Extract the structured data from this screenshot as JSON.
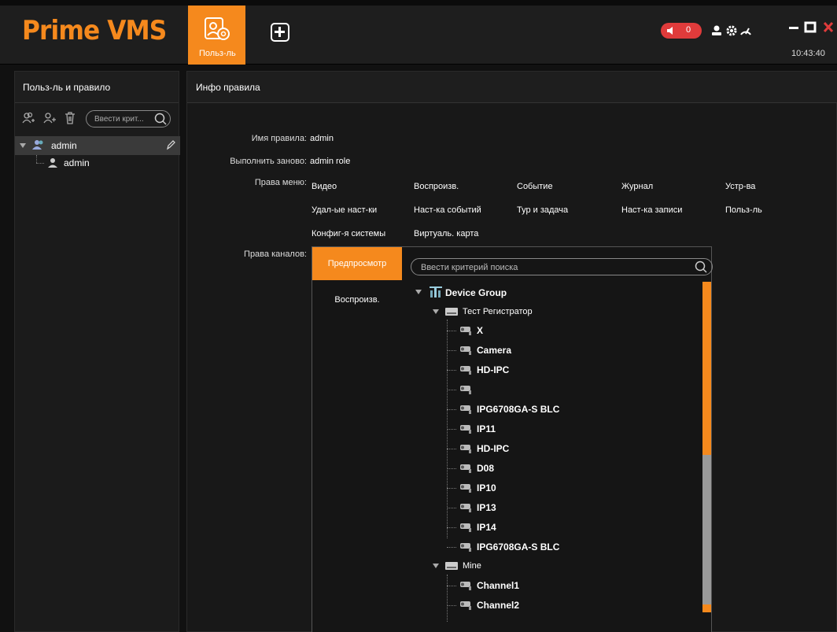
{
  "app": {
    "logo": "Prime VMS",
    "clock": "10:43:40"
  },
  "header": {
    "user_tab_label": "Польз-ль",
    "alarm_count": "0"
  },
  "left": {
    "title": "Польз-ль и правило",
    "search_placeholder": "Ввести крит...",
    "tree": {
      "group": "admin",
      "child": "admin"
    }
  },
  "right": {
    "title": "Инфо правила",
    "rule_name_label": "Имя правила:",
    "rule_name_value": "admin",
    "redo_label": "Выполнить заново:",
    "redo_value": "admin role",
    "menu_rights_label": "Права меню:",
    "menu_rights": [
      "Видео",
      "Воспроизв.",
      "Событие",
      "Журнал",
      "Устр-ва",
      "Удал-ые наст-ки",
      "Наст-ка событий",
      "Тур и задача",
      "Наст-ка записи",
      "Польз-ль",
      "Конфиг-я системы",
      "Виртуаль. карта"
    ],
    "channel_rights_label": "Права каналов:",
    "channel_tabs": [
      "Предпросмотр",
      "Воспроизв."
    ],
    "channel_search_placeholder": "Ввести критерий поиска",
    "device_tree": {
      "root": "Device Group",
      "recorders": [
        {
          "name": "Тест Регистратор",
          "channels": [
            "X",
            "Camera",
            "HD-IPC",
            "",
            "IPG6708GA-S BLC",
            "IP11",
            "HD-IPC",
            "D08",
            "IP10",
            "IP13",
            "IP14",
            "IPG6708GA-S BLC"
          ]
        },
        {
          "name": "Mine",
          "channels": [
            "Channel1",
            "Channel2"
          ]
        }
      ]
    }
  },
  "colors": {
    "accent": "#f5891d",
    "alarm": "#e03b3b",
    "panel": "#1b1b1b"
  }
}
